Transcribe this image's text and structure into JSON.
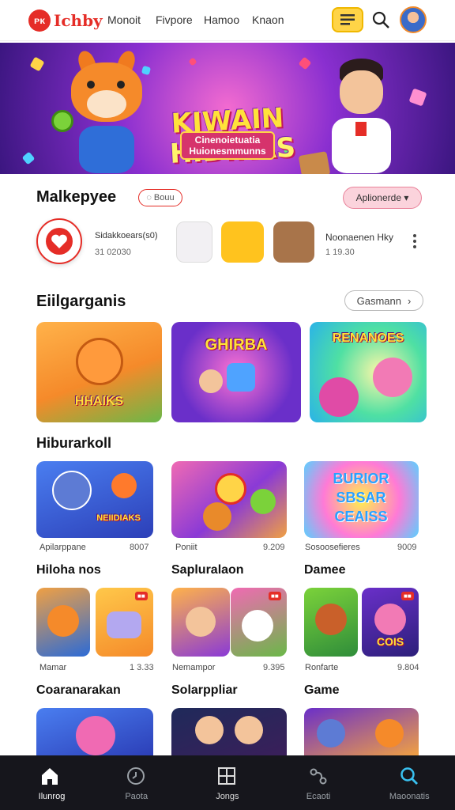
{
  "header": {
    "logo_mark": "ᴘᴋ",
    "logo_text": "Ichby",
    "nav": [
      "Monoit",
      "Fivpore",
      "Hamoo",
      "Knaon"
    ],
    "icons": {
      "menu": "menu-icon",
      "search": "search-icon",
      "avatar": "avatar"
    }
  },
  "banner": {
    "title_line1": "KIWAIN",
    "title_line2": "HIDIKAS",
    "subtitle": "Cinenoietuatia Huionesmmunns"
  },
  "market": {
    "title": "Malkepyee",
    "tag": "◌ Bouu",
    "action": "Aplionerde ▾",
    "item1_name": "Sidakkoears(s0)",
    "item1_value": "31 02030",
    "item2_name": "Noonaenen Hky",
    "item2_value": "1 19.30"
  },
  "featured": {
    "title": "Eiilgarganis",
    "action": "Gasmann",
    "cards": [
      {
        "title": "HHAIKS",
        "badge": ""
      },
      {
        "title": "GHIRBA",
        "badge": ""
      },
      {
        "title": "RENANOES",
        "badge": ""
      }
    ]
  },
  "section2": {
    "title": "Hiburarkoll",
    "cards": [
      {
        "title": "NEIIDIAKS",
        "caption": "Apilarppane",
        "num": "8007"
      },
      {
        "title": "",
        "caption": "Poniit",
        "num": "9.209"
      },
      {
        "title": "BURIOR SBSAR CEAISS",
        "caption": "Sosoosefieres",
        "num": "9009"
      }
    ]
  },
  "section3": {
    "columns": [
      {
        "title": "Hiloha nos",
        "caption": "Mamar",
        "num": "1 3.33"
      },
      {
        "title": "Sapluralaon",
        "caption": "Nemampor",
        "num": "9.395"
      },
      {
        "title": "Damee",
        "caption": "Ronfarte",
        "num": "9.804"
      }
    ]
  },
  "section4": {
    "columns": [
      {
        "title": "Coaranarakan"
      },
      {
        "title": "Solarppliar"
      },
      {
        "title": "Game"
      }
    ]
  },
  "bottom_nav": [
    {
      "label": "Ilunrog",
      "icon": "home-icon"
    },
    {
      "label": "Paota",
      "icon": "clock-icon"
    },
    {
      "label": "Jongs",
      "icon": "grid-icon"
    },
    {
      "label": "Ecaoti",
      "icon": "share-icon"
    },
    {
      "label": "Maoonatis",
      "icon": "search-icon"
    }
  ],
  "colors": {
    "brand": "#e52d27",
    "accent": "#ffd447",
    "nav_bg": "#16161c",
    "active_search": "#39c1f0"
  }
}
